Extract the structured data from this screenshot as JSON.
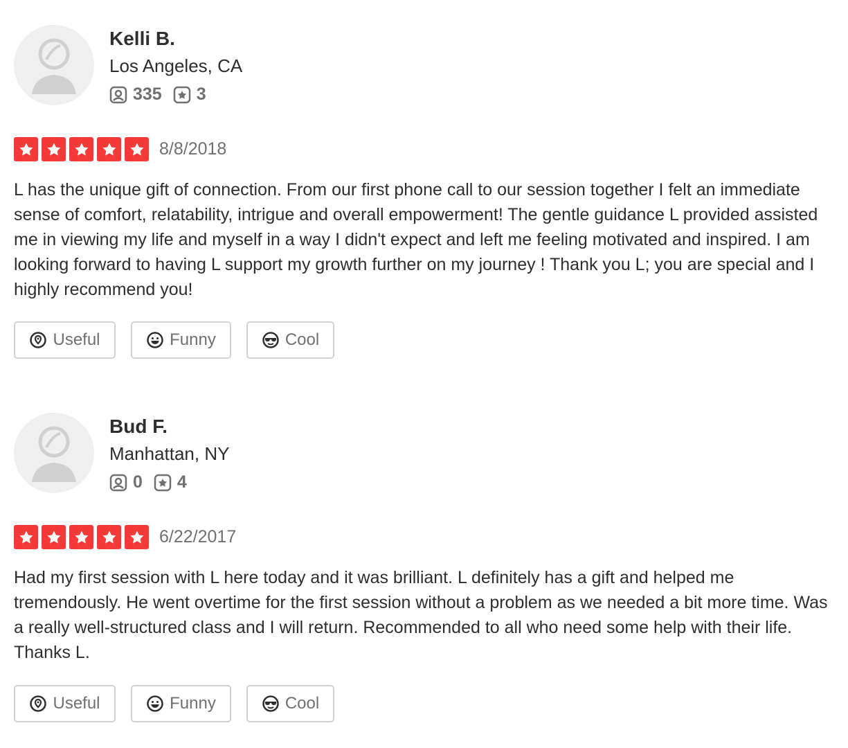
{
  "reviews": [
    {
      "name": "Kelli B.",
      "location": "Los Angeles, CA",
      "friends": "335",
      "review_count": "3",
      "rating": 5,
      "date": "8/8/2018",
      "text": "L has the unique gift of connection.  From our first phone call to our session together I felt an immediate sense of comfort, relatability, intrigue and overall empowerment!  The gentle guidance L provided assisted me in viewing my life and myself in a way I didn't expect and left me feeling motivated and inspired.  I am looking forward to having L support my growth further on my journey !  Thank you L; you are special and I highly recommend you!",
      "buttons": {
        "useful": "Useful",
        "funny": "Funny",
        "cool": "Cool"
      }
    },
    {
      "name": "Bud F.",
      "location": "Manhattan, NY",
      "friends": "0",
      "review_count": "4",
      "rating": 5,
      "date": "6/22/2017",
      "text": "Had my first session with L here today and it was brilliant. L definitely has a gift and helped me tremendously. He went overtime for the first session  without a problem as we needed a bit more time. Was a really well-structured class and I will return. Recommended to all who need some help with their life. Thanks L.",
      "buttons": {
        "useful": "Useful",
        "funny": "Funny",
        "cool": "Cool"
      }
    }
  ],
  "colors": {
    "star_bg": "#f43939",
    "muted": "#6e7072",
    "text": "#2d2e2f",
    "border": "#d2d2d2"
  }
}
